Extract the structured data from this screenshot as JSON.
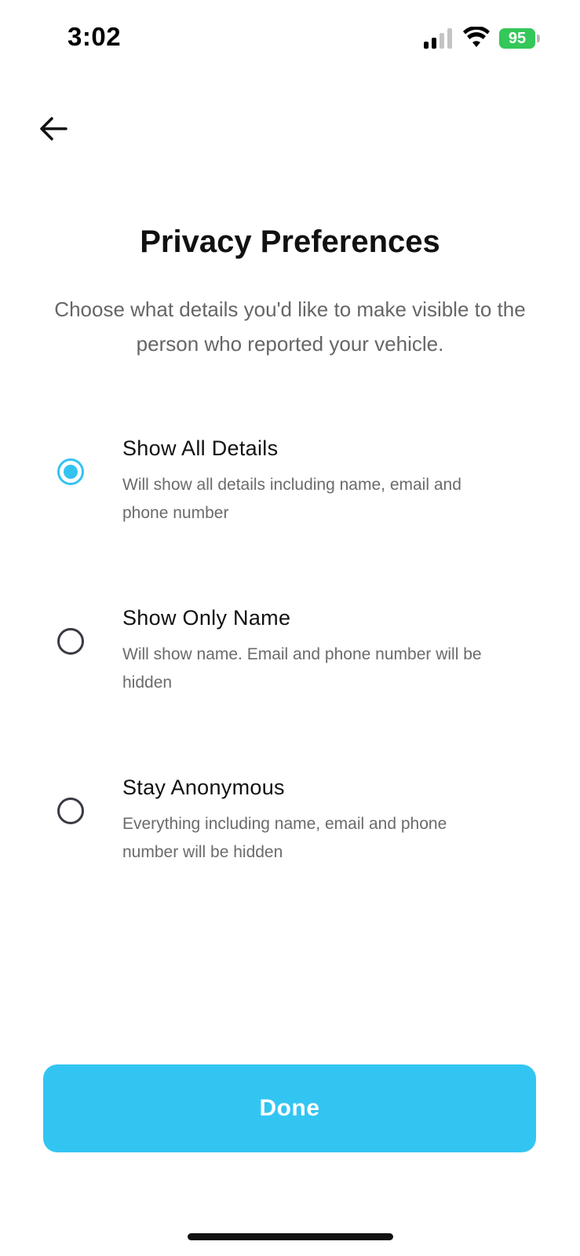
{
  "status_bar": {
    "time": "3:02",
    "battery": "95",
    "icons": [
      "signal-icon",
      "wifi-icon",
      "battery-icon"
    ]
  },
  "header": {
    "back_icon": "arrow-left-icon",
    "title": "Privacy Preferences",
    "subtitle": "Choose what details you'd like to make visible to the person who reported your vehicle."
  },
  "options": [
    {
      "title": "Show All Details",
      "description": "Will show all details including name, email and phone number",
      "selected": true
    },
    {
      "title": "Show Only Name",
      "description": "Will show name. Email and phone number will be hidden",
      "selected": false
    },
    {
      "title": "Stay Anonymous",
      "description": "Everything including name, email and phone number will be hidden",
      "selected": false
    }
  ],
  "actions": {
    "done_label": "Done"
  },
  "colors": {
    "accent": "#33c5f2",
    "battery": "#34c759",
    "radio_unselected": "#3a3a44",
    "muted_text": "#666666"
  }
}
